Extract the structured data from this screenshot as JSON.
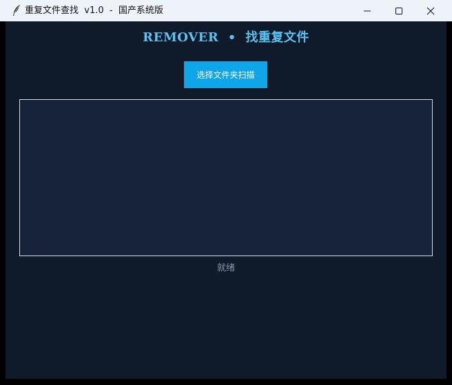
{
  "window": {
    "title": "重复文件查找  v1.0  -  国产系统版",
    "icon": "feather-icon",
    "controls": {
      "minimize": "minimize-icon",
      "maximize": "maximize-icon",
      "close": "close-icon"
    }
  },
  "main": {
    "heading": "REMOVER  •  找重复文件",
    "scan_button_label": "选择文件夹扫描",
    "status": "就绪"
  },
  "colors": {
    "background": "#0f1a2b",
    "panel": "#16233b",
    "accent": "#0ea5e9",
    "heading": "#5cc2f2",
    "status": "#8a96a8"
  }
}
